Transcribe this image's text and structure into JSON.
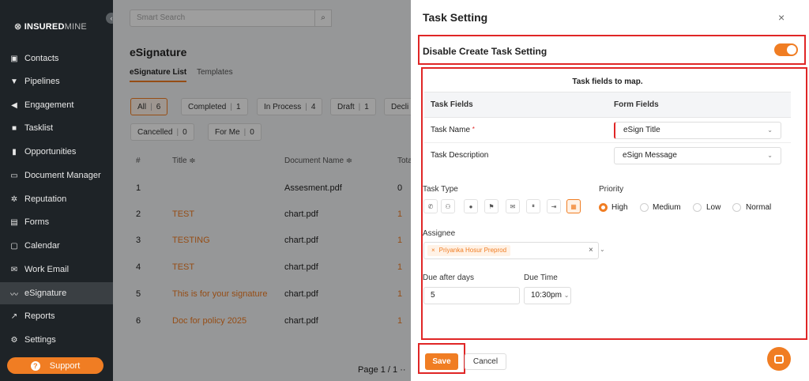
{
  "brand": {
    "prefix": "INSURED",
    "suffix": "MINE",
    "collapse": "‹"
  },
  "sidebar": {
    "items": [
      {
        "label": "Contacts",
        "icon": "contacts-icon",
        "glyph": "▣"
      },
      {
        "label": "Pipelines",
        "icon": "pipelines-icon",
        "glyph": "▼"
      },
      {
        "label": "Engagement",
        "icon": "megaphone-icon",
        "glyph": "◀"
      },
      {
        "label": "Tasklist",
        "icon": "tasklist-icon",
        "glyph": "■"
      },
      {
        "label": "Opportunities",
        "icon": "bar-chart-icon",
        "glyph": "▮"
      },
      {
        "label": "Document Manager",
        "icon": "folder-icon",
        "glyph": "▭"
      },
      {
        "label": "Reputation",
        "icon": "reputation-icon",
        "glyph": "✲"
      },
      {
        "label": "Forms",
        "icon": "forms-icon",
        "glyph": "▤"
      },
      {
        "label": "Calendar",
        "icon": "calendar-icon",
        "glyph": "▢"
      },
      {
        "label": "Work Email",
        "icon": "email-icon",
        "glyph": "✉"
      },
      {
        "label": "eSignature",
        "icon": "signature-icon",
        "glyph": "〰"
      },
      {
        "label": "Reports",
        "icon": "line-chart-icon",
        "glyph": "↗"
      },
      {
        "label": "Settings",
        "icon": "gear-icon",
        "glyph": "⚙"
      }
    ],
    "support": "Support",
    "support_glyph": "?"
  },
  "main": {
    "search_placeholder": "Smart Search",
    "search_glyph": "⌕",
    "title": "eSignature",
    "tabs": [
      "eSignature List",
      "Templates"
    ],
    "filters": [
      {
        "label": "All",
        "count": "6"
      },
      {
        "label": "Completed",
        "count": "1"
      },
      {
        "label": "In Process",
        "count": "4"
      },
      {
        "label": "Draft",
        "count": "1"
      },
      {
        "label": "Decli",
        "count": ""
      },
      {
        "label": "Cancelled",
        "count": "0"
      },
      {
        "label": "For Me",
        "count": "0"
      }
    ],
    "columns": [
      "#",
      "Title ≑",
      "Document Name ≑",
      "Tota"
    ],
    "rows": [
      {
        "num": "1",
        "title": "",
        "doc": "Assesment.pdf",
        "total": "0"
      },
      {
        "num": "2",
        "title": "TEST",
        "doc": "chart.pdf",
        "total": "1"
      },
      {
        "num": "3",
        "title": "TESTING",
        "doc": "chart.pdf",
        "total": "1"
      },
      {
        "num": "4",
        "title": "TEST",
        "doc": "chart.pdf",
        "total": "1"
      },
      {
        "num": "5",
        "title": "This is for your signature",
        "doc": "chart.pdf",
        "total": "1"
      },
      {
        "num": "6",
        "title": "Doc for policy 2025",
        "doc": "chart.pdf",
        "total": "1"
      }
    ],
    "pager": "Page 1 / 1  ··"
  },
  "panel": {
    "title": "Task Setting",
    "close": "×",
    "disable_label": "Disable Create Task Setting",
    "map_title": "Task fields to map.",
    "col_task": "Task Fields",
    "col_form": "Form Fields",
    "task_name_label": "Task Name",
    "task_name_req": "*",
    "task_name_value": "eSign Title",
    "task_desc_label": "Task Description",
    "task_desc_value": "eSign Message",
    "chevron": "⌄",
    "task_type_label": "Task Type",
    "task_types": [
      {
        "icon": "phone-icon",
        "glyph": "✆"
      },
      {
        "icon": "meeting-icon",
        "glyph": "⚇"
      },
      {
        "icon": "clock-icon",
        "glyph": "●"
      },
      {
        "icon": "flag-icon",
        "glyph": "⚑"
      },
      {
        "icon": "mail-icon",
        "glyph": "✉"
      },
      {
        "icon": "pause-icon",
        "glyph": "⏸"
      },
      {
        "icon": "logout-icon",
        "glyph": "⇥"
      },
      {
        "icon": "document-icon",
        "glyph": "▦"
      }
    ],
    "priority_label": "Priority",
    "priorities": [
      "High",
      "Medium",
      "Low",
      "Normal"
    ],
    "assignee_label": "Assignee",
    "assignee_chip": "Priyanka Hosur Preprod",
    "chip_x": "×",
    "assignee_clear": "×",
    "due_days_label": "Due after days",
    "due_days_value": "5",
    "due_time_label": "Due Time",
    "due_time_value": "10:30pm",
    "save": "Save",
    "cancel": "Cancel"
  }
}
